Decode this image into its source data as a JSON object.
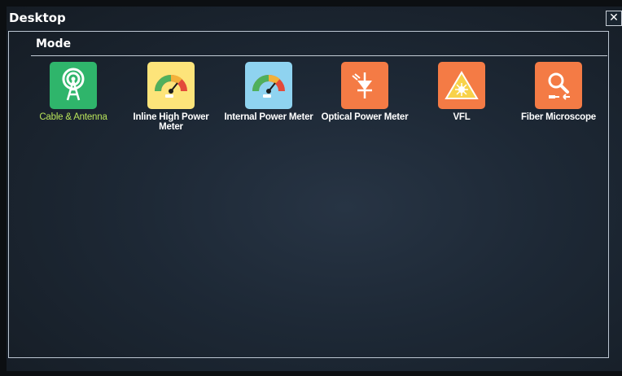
{
  "window": {
    "title": "Desktop",
    "close_glyph": "✕"
  },
  "section": {
    "title": "Mode"
  },
  "tiles": [
    {
      "label": "Cable & Antenna",
      "icon": "antenna-icon",
      "color": "#2fb56b",
      "selected": true
    },
    {
      "label": "Inline High Power Meter",
      "icon": "gauge-icon",
      "color": "#fde47a",
      "selected": false
    },
    {
      "label": "Internal Power Meter",
      "icon": "gauge-icon",
      "color": "#8fd3f0",
      "selected": false
    },
    {
      "label": "Optical Power Meter",
      "icon": "photodiode-icon",
      "color": "#f47b45",
      "selected": false
    },
    {
      "label": "VFL",
      "icon": "laser-warning-icon",
      "color": "#f47b45",
      "selected": false
    },
    {
      "label": "Fiber Microscope",
      "icon": "microscope-icon",
      "color": "#f47b45",
      "selected": false
    }
  ],
  "colors": {
    "selected_label": "#b8e35a",
    "label": "#ffffff"
  }
}
